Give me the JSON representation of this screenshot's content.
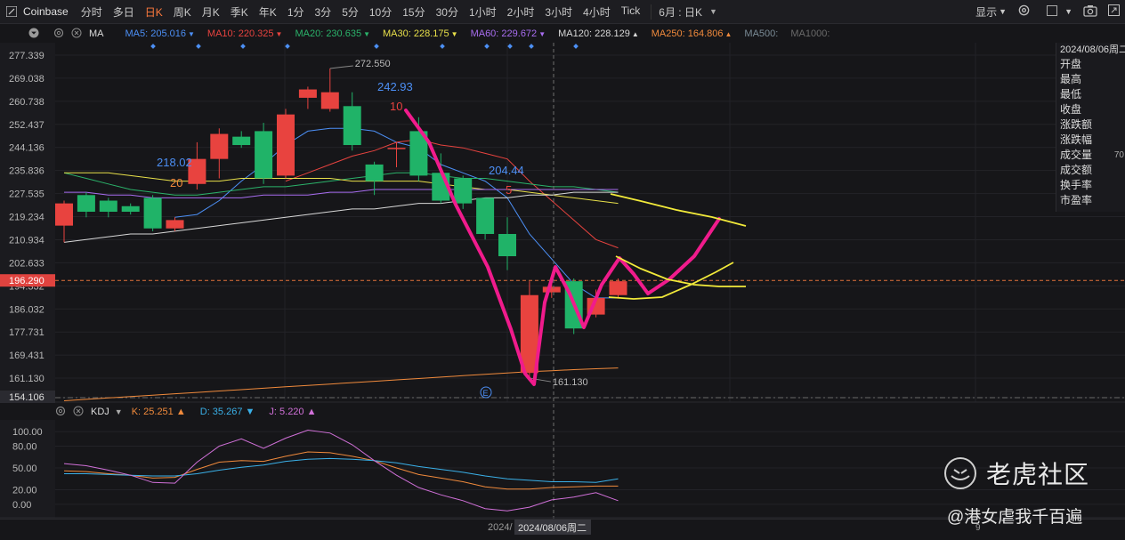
{
  "toolbar": {
    "symbol": "Coinbase",
    "timeframes": [
      "分时",
      "多日",
      "日K",
      "周K",
      "月K",
      "季K",
      "年K",
      "1分",
      "3分",
      "5分",
      "10分",
      "15分",
      "30分",
      "1小时",
      "2小时",
      "3小时",
      "4小时",
      "Tick"
    ],
    "active_timeframe": "日K",
    "period_dropdown": "6月 : 日K",
    "display_label": "显示"
  },
  "ma_legend": {
    "name": "MA",
    "items": [
      {
        "label": "MA5: 205.016",
        "arrow": "▼",
        "color": "#4c8ff5"
      },
      {
        "label": "MA10: 220.325",
        "arrow": "▼",
        "color": "#e8433f"
      },
      {
        "label": "MA20: 230.635",
        "arrow": "▼",
        "color": "#2bb26a"
      },
      {
        "label": "MA30: 228.175",
        "arrow": "▼",
        "color": "#e8e04a"
      },
      {
        "label": "MA60: 229.672",
        "arrow": "▼",
        "color": "#a86df0"
      },
      {
        "label": "MA120: 228.129",
        "arrow": "▲",
        "color": "#d8d8d8"
      },
      {
        "label": "MA250: 164.806",
        "arrow": "▲",
        "color": "#f08a3c"
      },
      {
        "label": "MA500:",
        "arrow": "",
        "color": "#7a8b96"
      },
      {
        "label": "MA1000:",
        "arrow": "",
        "color": "#6a6a6a"
      }
    ]
  },
  "price_axis": {
    "ticks": [
      "277.339",
      "269.038",
      "260.738",
      "252.437",
      "244.136",
      "235.836",
      "227.535",
      "219.234",
      "210.934",
      "202.633",
      "194.332",
      "186.032",
      "177.731",
      "169.431",
      "161.130",
      "154.106"
    ],
    "current_price": "196.290"
  },
  "chart_data": {
    "type": "candlestick",
    "y_range": [
      154.106,
      277.339
    ],
    "candles": [
      {
        "o": 216,
        "c": 224,
        "h": 225,
        "l": 210
      },
      {
        "o": 227,
        "c": 221,
        "h": 228,
        "l": 219
      },
      {
        "o": 225,
        "c": 221,
        "h": 226,
        "l": 219
      },
      {
        "o": 223,
        "c": 221,
        "h": 224,
        "l": 220
      },
      {
        "o": 226,
        "c": 215,
        "h": 227,
        "l": 214
      },
      {
        "o": 215,
        "c": 218,
        "h": 219,
        "l": 214
      },
      {
        "o": 231,
        "c": 240,
        "h": 246,
        "l": 229
      },
      {
        "o": 240,
        "c": 249,
        "h": 251,
        "l": 233
      },
      {
        "o": 248,
        "c": 245,
        "h": 250,
        "l": 244
      },
      {
        "o": 250,
        "c": 233,
        "h": 253,
        "l": 231
      },
      {
        "o": 234,
        "c": 256,
        "h": 258,
        "l": 233
      },
      {
        "o": 262,
        "c": 265,
        "h": 266,
        "l": 258
      },
      {
        "o": 258,
        "c": 264,
        "h": 272.55,
        "l": 257
      },
      {
        "o": 259,
        "c": 245,
        "h": 264,
        "l": 243
      },
      {
        "o": 238,
        "c": 232,
        "h": 239,
        "l": 227
      },
      {
        "o": 244,
        "c": 244,
        "h": 246,
        "l": 237
      },
      {
        "o": 250,
        "c": 234,
        "h": 255,
        "l": 232
      },
      {
        "o": 235,
        "c": 225,
        "h": 242,
        "l": 224
      },
      {
        "o": 233,
        "c": 224,
        "h": 234,
        "l": 222
      },
      {
        "o": 226,
        "c": 213,
        "h": 226,
        "l": 211
      },
      {
        "o": 213,
        "c": 205,
        "h": 219,
        "l": 200
      },
      {
        "o": 163,
        "c": 191,
        "h": 196,
        "l": 161.13
      },
      {
        "o": 192,
        "c": 194,
        "h": 195,
        "l": 190
      },
      {
        "o": 196,
        "c": 179,
        "h": 197,
        "l": 177
      },
      {
        "o": 184,
        "c": 190,
        "h": 193,
        "l": 183
      },
      {
        "o": 191,
        "c": 196,
        "h": 197,
        "l": 190
      }
    ],
    "ma_lines": [
      {
        "name": "MA5",
        "color": "#4c8ff5",
        "values": [
          null,
          null,
          null,
          null,
          null,
          219,
          220,
          225,
          232,
          238,
          245,
          250,
          251,
          251,
          250,
          246,
          244,
          238,
          235,
          232,
          226,
          213,
          204,
          195,
          190,
          190
        ]
      },
      {
        "name": "MA10",
        "color": "#e8433f",
        "values": [
          null,
          null,
          null,
          null,
          null,
          null,
          null,
          null,
          null,
          null,
          232,
          235,
          238,
          241,
          243,
          246,
          247,
          245,
          244,
          242,
          240,
          232,
          225,
          218,
          211,
          208
        ]
      },
      {
        "name": "MA20",
        "color": "#2bb26a",
        "values": [
          235,
          233,
          231,
          229,
          228,
          227,
          227,
          228,
          229,
          230,
          230,
          231,
          232,
          233,
          234,
          235,
          235,
          234,
          233,
          233,
          232,
          231,
          230,
          230,
          229,
          228
        ]
      },
      {
        "name": "MA30",
        "color": "#e8e04a",
        "values": [
          235,
          235,
          235,
          234,
          233,
          232,
          232,
          232,
          233,
          233,
          233,
          233,
          233,
          232,
          232,
          232,
          232,
          231,
          230,
          229,
          229,
          228,
          227,
          226,
          225,
          224
        ]
      },
      {
        "name": "MA60",
        "color": "#a86df0",
        "values": [
          228,
          228,
          227,
          227,
          226,
          226,
          226,
          226,
          226,
          227,
          227,
          227,
          228,
          228,
          229,
          229,
          229,
          229,
          229,
          229,
          229,
          229,
          229,
          229,
          229,
          229
        ]
      },
      {
        "name": "MA120",
        "color": "#d8d8d8",
        "values": [
          210,
          211,
          212,
          213,
          213,
          214,
          215,
          216,
          217,
          218,
          219,
          220,
          221,
          222,
          222,
          223,
          224,
          224,
          225,
          226,
          226,
          227,
          227,
          228,
          228,
          228
        ]
      },
      {
        "name": "MA250",
        "color": "#f08a3c",
        "values": [
          153,
          153.5,
          154,
          154.5,
          155,
          155.5,
          156,
          156.5,
          157,
          157.5,
          158,
          158.5,
          159,
          159.5,
          160,
          160.5,
          161,
          161.5,
          162,
          162.5,
          163,
          163.5,
          163.8,
          164.2,
          164.5,
          164.8
        ]
      }
    ],
    "annotations": {
      "high_label": "272.550",
      "low_label": "161.130",
      "text_labels": [
        {
          "text": "242.93",
          "color": "#4c8ff5"
        },
        {
          "text": "10",
          "color": "#e8433f"
        },
        {
          "text": "218.02",
          "color": "#4c8ff5"
        },
        {
          "text": "20",
          "color": "#f08a3c"
        },
        {
          "text": "204.44",
          "color": "#4c8ff5"
        },
        {
          "text": "5",
          "color": "#e8433f"
        }
      ],
      "event_marker": "E"
    }
  },
  "kdj": {
    "legend": {
      "name": "KDJ",
      "k": "K: 25.251",
      "d": "D: 35.267",
      "j": "J: 5.220",
      "k_color": "#f08a3c",
      "d_color": "#3ab0e8",
      "j_color": "#d070d8"
    },
    "axis_ticks": [
      "100.00",
      "80.00",
      "50.00",
      "20.00",
      "0.00"
    ],
    "k_values": [
      46,
      45,
      42,
      40,
      36,
      37,
      48,
      58,
      60,
      59,
      66,
      72,
      71,
      66,
      60,
      50,
      41,
      36,
      31,
      24,
      21,
      21,
      23,
      24,
      25,
      25
    ],
    "d_values": [
      42,
      42,
      41,
      40,
      39,
      39,
      42,
      47,
      51,
      54,
      59,
      62,
      63,
      62,
      60,
      57,
      52,
      48,
      44,
      39,
      35,
      33,
      31,
      31,
      30,
      35
    ],
    "j_values": [
      56,
      53,
      47,
      40,
      30,
      29,
      58,
      80,
      90,
      77,
      91,
      102,
      98,
      82,
      60,
      40,
      23,
      13,
      5,
      -6,
      -9,
      -4,
      6,
      10,
      16,
      5
    ]
  },
  "info_panel": {
    "date": "2024/08/06周二",
    "fields": [
      {
        "label": "开盘",
        "value": ""
      },
      {
        "label": "最高",
        "value": ""
      },
      {
        "label": "最低",
        "value": ""
      },
      {
        "label": "收盘",
        "value": ""
      },
      {
        "label": "涨跌额",
        "value": ""
      },
      {
        "label": "涨跌幅",
        "value": ""
      },
      {
        "label": "成交量",
        "value": "70"
      },
      {
        "label": "成交额",
        "value": ""
      },
      {
        "label": "换手率",
        "value": ""
      },
      {
        "label": "市盈率",
        "value": ""
      }
    ]
  },
  "date_axis": {
    "left_label": "2024/",
    "crosshair_label": "2024/08/06周二",
    "right_label": "9"
  },
  "watermark": {
    "title": "老虎社区",
    "user": "@港女虐我千百遍"
  }
}
